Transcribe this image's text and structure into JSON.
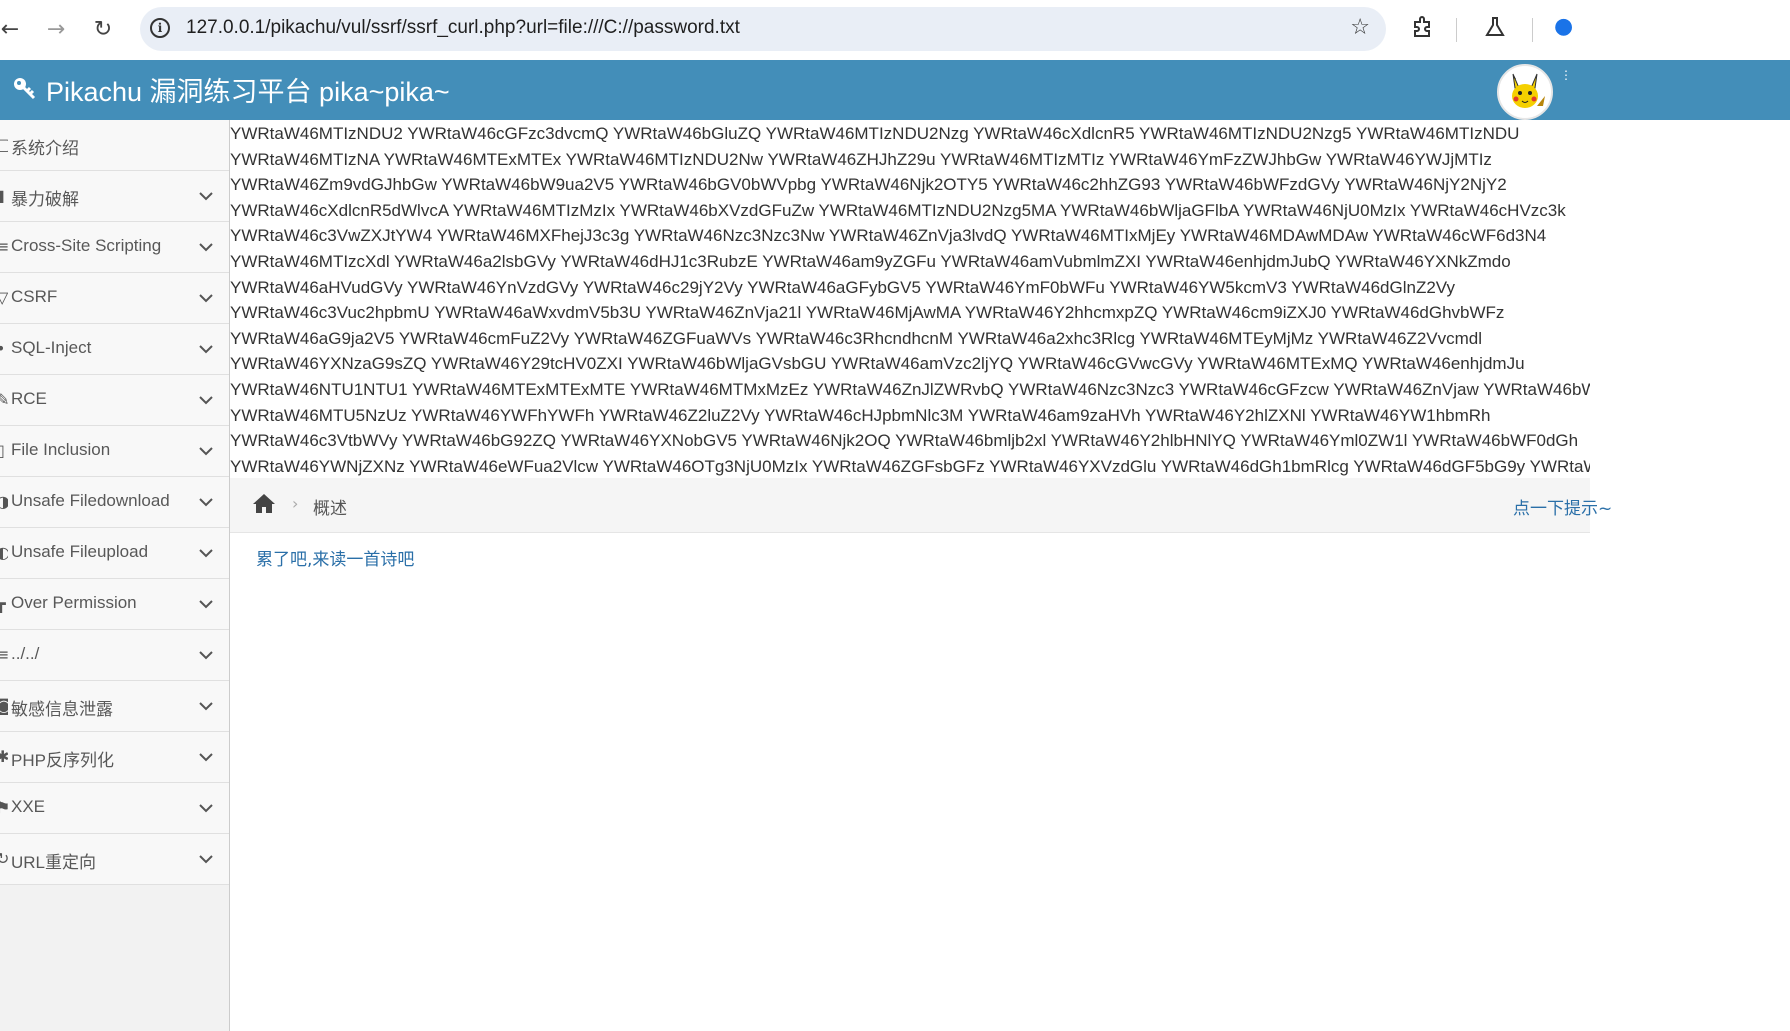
{
  "browser": {
    "url": "127.0.0.1/pikachu/vul/ssrf/ssrf_curl.php?url=file:///C://password.txt"
  },
  "header": {
    "title": "Pikachu 漏洞练习平台 pika~pika~"
  },
  "sidebar": {
    "items": [
      {
        "label": "系统介绍",
        "icon": "desktop-icon",
        "has_submenu": false
      },
      {
        "label": "暴力破解",
        "icon": "lock-icon",
        "has_submenu": true
      },
      {
        "label": "Cross-Site Scripting",
        "icon": "list-icon",
        "has_submenu": true
      },
      {
        "label": "CSRF",
        "icon": "glass-icon",
        "has_submenu": true
      },
      {
        "label": "SQL-Inject",
        "icon": "fire-icon",
        "has_submenu": true
      },
      {
        "label": "RCE",
        "icon": "pencil-icon",
        "has_submenu": true
      },
      {
        "label": "File Inclusion",
        "icon": "file-icon",
        "has_submenu": true
      },
      {
        "label": "Unsafe Filedownload",
        "icon": "download-icon",
        "has_submenu": true
      },
      {
        "label": "Unsafe Fileupload",
        "icon": "upload-icon",
        "has_submenu": true
      },
      {
        "label": "Over Permission",
        "icon": "key-icon",
        "has_submenu": true
      },
      {
        "label": "../../",
        "icon": "list-icon",
        "has_submenu": true
      },
      {
        "label": "敏感信息泄露",
        "icon": "camera-icon",
        "has_submenu": true
      },
      {
        "label": "PHP反序列化",
        "icon": "cogs-icon",
        "has_submenu": true
      },
      {
        "label": "XXE",
        "icon": "flag-icon",
        "has_submenu": true
      },
      {
        "label": "URL重定向",
        "icon": "refresh-icon",
        "has_submenu": true
      }
    ]
  },
  "curl_output": {
    "lines": [
      "YWRtaW46MTIzNDU2 YWRtaW46cGFzc3dvcmQ YWRtaW46bGluZQ YWRtaW46MTIzNDU2Nzg YWRtaW46cXdlcnR5 YWRtaW46MTIzNDU2Nzg5 YWRtaW46MTIzNDU",
      "YWRtaW46MTIzNA YWRtaW46MTExMTEx YWRtaW46MTIzNDU2Nw YWRtaW46ZHJhZ29u YWRtaW46MTIzMTIz YWRtaW46YmFzZWJhbGw YWRtaW46YWJjMTIz",
      "YWRtaW46Zm9vdGJhbGw YWRtaW46bW9ua2V5 YWRtaW46bGV0bWVpbg YWRtaW46Njk2OTY5 YWRtaW46c2hhZG93 YWRtaW46bWFzdGVy YWRtaW46NjY2NjY2",
      "YWRtaW46cXdlcnR5dWlvcA YWRtaW46MTIzMzIx YWRtaW46bXVzdGFuZw YWRtaW46MTIzNDU2Nzg5MA YWRtaW46bWljaGFlbA YWRtaW46NjU0MzIx YWRtaW46cHVzc3k",
      "YWRtaW46c3VwZXJtYW4 YWRtaW46MXFhejJ3c3g YWRtaW46Nzc3Nzc3Nw YWRtaW46ZnVja3lvdQ YWRtaW46MTIxMjEy YWRtaW46MDAwMDAw YWRtaW46cWF6d3N4",
      "YWRtaW46MTIzcXdl YWRtaW46a2lsbGVy YWRtaW46dHJ1c3RubzE YWRtaW46am9yZGFu YWRtaW46amVubmlmZXI YWRtaW46enhjdmJubQ YWRtaW46YXNkZmdo",
      "YWRtaW46aHVudGVy YWRtaW46YnVzdGVy YWRtaW46c29jY2Vy YWRtaW46aGFybGV5 YWRtaW46YmF0bWFu YWRtaW46YW5kcmV3 YWRtaW46dGlnZ2Vy",
      "YWRtaW46c3Vuc2hpbmU YWRtaW46aWxvdmV5b3U YWRtaW46ZnVja21l YWRtaW46MjAwMA YWRtaW46Y2hhcmxpZQ YWRtaW46cm9iZXJ0 YWRtaW46dGhvbWFz",
      "YWRtaW46aG9ja2V5 YWRtaW46cmFuZ2Vy YWRtaW46ZGFuaWVs YWRtaW46c3RhcndhcnM YWRtaW46a2xhc3Rlcg YWRtaW46MTEyMjMz YWRtaW46Z2Vvcmdl",
      "YWRtaW46YXNzaG9sZQ YWRtaW46Y29tcHV0ZXI YWRtaW46bWljaGVsbGU YWRtaW46amVzc2ljYQ YWRtaW46cGVwcGVy YWRtaW46MTExMQ YWRtaW46enhjdmJu",
      "YWRtaW46NTU1NTU1 YWRtaW46MTExMTExMTE YWRtaW46MTMxMzEz YWRtaW46ZnJlZWRvbQ YWRtaW46Nzc3Nzc3 YWRtaW46cGFzcw YWRtaW46ZnVjaw YWRtaW46bW",
      "YWRtaW46MTU5NzUz YWRtaW46YWFhYWFh YWRtaW46Z2luZ2Vy YWRtaW46cHJpbmNlc3M YWRtaW46am9zaHVh YWRtaW46Y2hlZXNl YWRtaW46YW1hbmRh",
      "YWRtaW46c3VtbWVy YWRtaW46bG92ZQ YWRtaW46YXNobGV5 YWRtaW46Njk2OQ YWRtaW46bmljb2xl YWRtaW46Y2hlbHNlYQ YWRtaW46Yml0ZW1l YWRtaW46bWF0dGh",
      "YWRtaW46YWNjZXNz YWRtaW46eWFua2Vlcw YWRtaW46OTg3NjU0MzIx YWRtaW46ZGFsbGFz YWRtaW46YXVzdGlu YWRtaW46dGh1bmRlcg YWRtaW46dGF5bG9y YWRtaW"
    ]
  },
  "breadcrumbs": {
    "current": "概述",
    "right_link": "点一下提示~"
  },
  "main": {
    "poem_link": "累了吧,来读一首诗吧"
  }
}
